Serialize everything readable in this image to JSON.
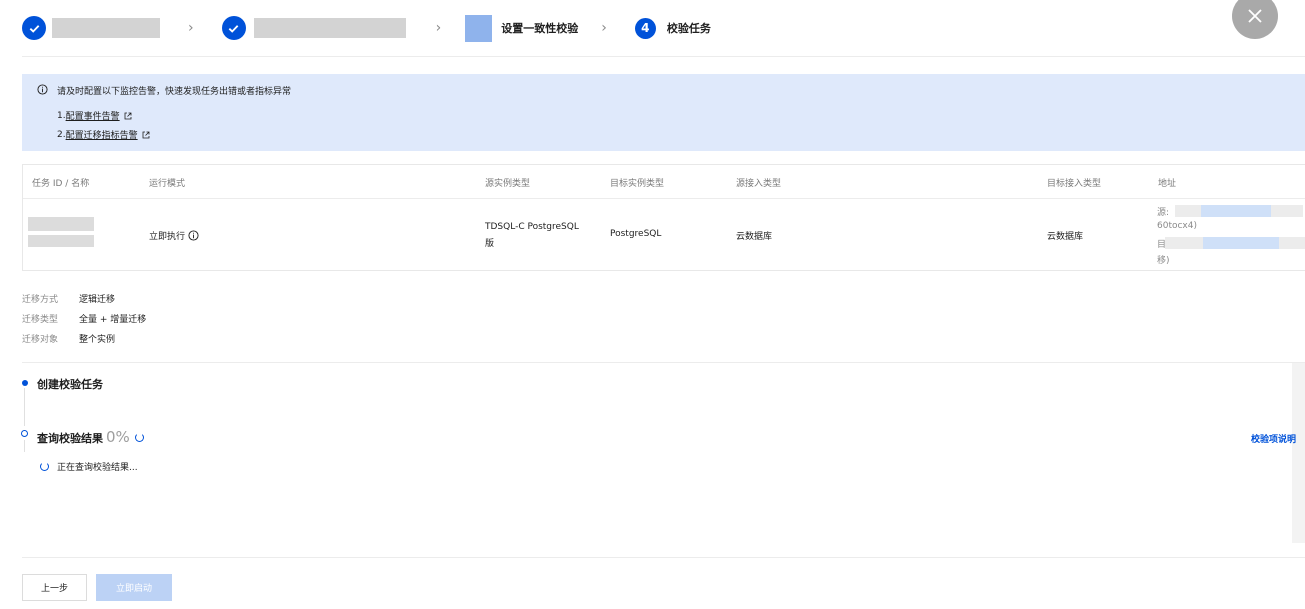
{
  "steps": [
    {
      "state": "done"
    },
    {
      "state": "done"
    },
    {
      "label": "设置一致性校验"
    },
    {
      "number": "4",
      "label": "校验任务"
    }
  ],
  "alert": {
    "message": "请及时配置以下监控告警，快速发现任务出错或者指标异常",
    "items": [
      {
        "prefix": "1. ",
        "link": "配置事件告警"
      },
      {
        "prefix": "2. ",
        "link": "配置迁移指标告警"
      }
    ]
  },
  "table": {
    "columns": [
      "任务 ID / 名称",
      "运行模式",
      "源实例类型",
      "目标实例类型",
      "源接入类型",
      "目标接入类型",
      "地址"
    ],
    "row": {
      "run_mode": "立即执行",
      "source_instance_type_1": "TDSQL-C PostgreSQL",
      "source_instance_type_2": "版",
      "target_instance_type": "PostgreSQL",
      "source_access_type": "云数据库",
      "target_access_type": "云数据库",
      "address_line1": "源:",
      "address_line2": "60tocx4)",
      "address_line3": "目",
      "address_line4": "移)"
    }
  },
  "info": [
    {
      "key": "迁移方式",
      "value": "逻辑迁移"
    },
    {
      "key": "迁移类型",
      "value": "全量 + 增量迁移"
    },
    {
      "key": "迁移对象",
      "value": "整个实例"
    }
  ],
  "timeline": {
    "step1": "创建校验任务",
    "step2": "查询校验结果",
    "progress": "0%",
    "querying": "正在查询校验结果...",
    "explain_link": "校验项说明"
  },
  "footer": {
    "prev": "上一步",
    "start": "立即启动"
  },
  "colors": {
    "primary": "#0052d9",
    "alert_bg": "#dfe9fb"
  }
}
